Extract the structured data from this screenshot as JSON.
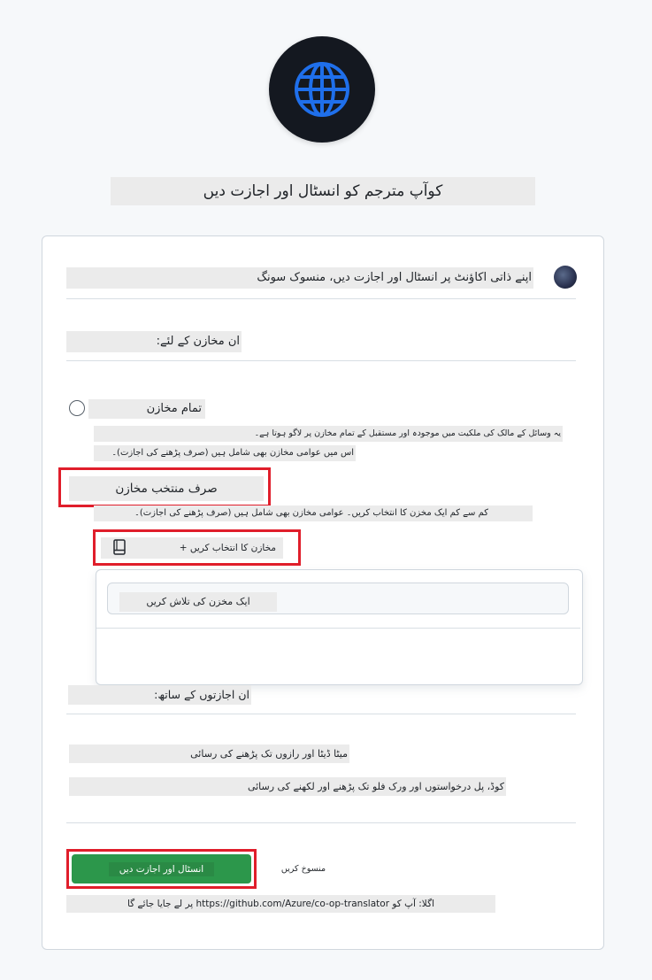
{
  "page": {
    "title": "کوآپ مترجم کو انسٹال اور اجازت دیں"
  },
  "account": {
    "line": "اپنے ذاتی اکاؤنٹ پر انسٹال اور اجازت دیں، منسوک سونگ"
  },
  "repositories": {
    "heading": "ان مخازن کے لئے:",
    "all": {
      "label": "تمام مخازن",
      "desc_line1": "یہ وسائل کے مالک کی ملکیت میں موجودہ اور مستقبل کے تمام مخازن پر لاگو ہوتا ہے۔",
      "desc_line2": "اس میں عوامی مخازن بھی شامل ہیں (صرف پڑھنے کی اجازت)۔"
    },
    "selected": {
      "label": "صرف منتخب مخازن",
      "desc": "کم سے کم ایک مخزن کا انتخاب کریں۔ عوامی مخازن بھی شامل ہیں (صرف پڑھنے کی اجازت)۔",
      "select_button": "مخازن کا انتخاب کریں +",
      "search_placeholder": "ایک مخزن کی تلاش کریں"
    }
  },
  "permissions": {
    "heading": "ان اجازتوں کے ساتھ:",
    "items": [
      "میٹا ڈیٹا اور رازوں تک پڑھنے کی رسائی",
      "کوڈ، پل درخواستوں اور ورک فلو تک پڑھنے اور لکھنے کی رسائی"
    ]
  },
  "actions": {
    "install_label": "انسٹال اور اجازت دیں",
    "cancel_label": "منسوخ کریں",
    "redirect_note": "اگلا: آپ کو https://github.com/Azure/co-op-translator پر لے جایا جائے گا"
  },
  "icons": {
    "logo": "globe-icon",
    "select": "repo-book-icon"
  },
  "colors": {
    "accent_green": "#2c974b",
    "highlight_red": "#e01e2b",
    "logo_blue": "#1f6feb"
  }
}
